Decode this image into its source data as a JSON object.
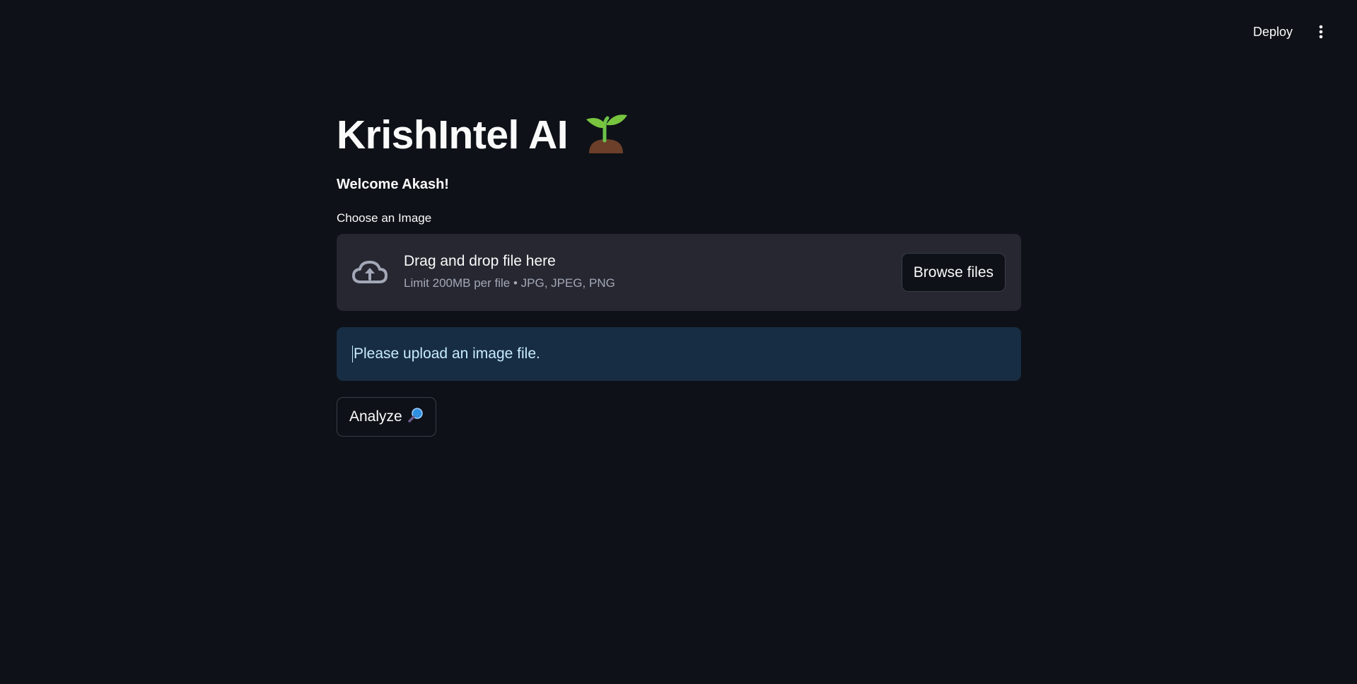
{
  "header": {
    "deploy_label": "Deploy",
    "menu_icon": "vertical-ellipsis-icon"
  },
  "main": {
    "title": "KrishIntel AI",
    "title_icon": "seedling-icon",
    "welcome": "Welcome Akash!",
    "uploader": {
      "label": "Choose an Image",
      "icon": "cloud-upload-icon",
      "dropzone_title": "Drag and drop file here",
      "dropzone_subtitle": "Limit 200MB per file • JPG, JPEG, PNG",
      "browse_label": "Browse files"
    },
    "alert": {
      "text": "Please upload an image file."
    },
    "analyze": {
      "label": "Analyze",
      "icon": "magnifier-icon"
    }
  },
  "colors": {
    "background": "#0e1117",
    "dropzone": "#262730",
    "info_background": "#172d43",
    "info_text": "#c7ebff"
  }
}
